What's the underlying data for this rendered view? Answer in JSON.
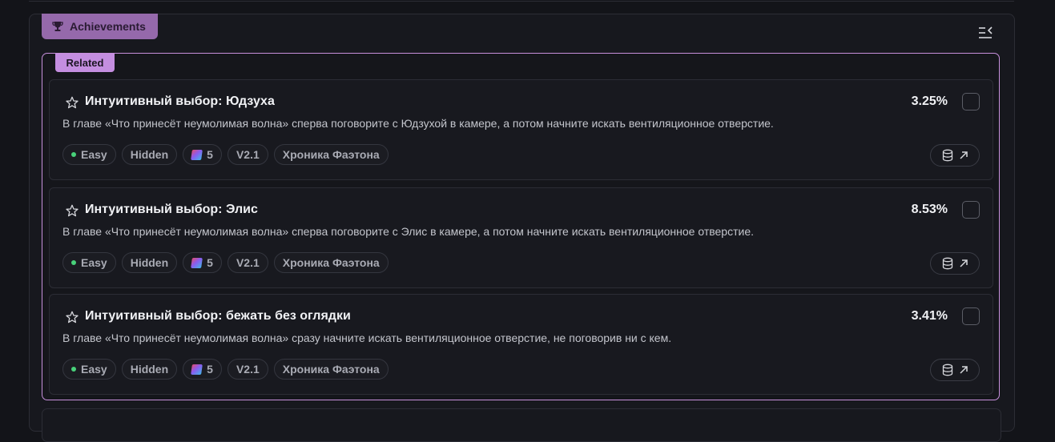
{
  "section": {
    "tab_label": "Achievements",
    "related_label": "Related",
    "collapse_icon": "collapse-list-icon"
  },
  "colors": {
    "accent": "#9569ab",
    "related_border": "#c790dc",
    "easy_dot": "#48d17a"
  },
  "achievements": [
    {
      "title": "Интуитивный выбор: Юдзуха",
      "percent": "3.25%",
      "description": "В главе «Что принесёт неумолимая волна» сперва поговорите с Юдзухой в камере, а потом начните искать вентиляционное отверстие.",
      "difficulty": "Easy",
      "visibility": "Hidden",
      "reward": "5",
      "version": "V2.1",
      "category": "Хроника Фаэтона"
    },
    {
      "title": "Интуитивный выбор: Элис",
      "percent": "8.53%",
      "description": "В главе «Что принесёт неумолимая волна» сперва поговорите с Элис в камере, а потом начните искать вентиляционное отверстие.",
      "difficulty": "Easy",
      "visibility": "Hidden",
      "reward": "5",
      "version": "V2.1",
      "category": "Хроника Фаэтона"
    },
    {
      "title": "Интуитивный выбор: бежать без оглядки",
      "percent": "3.41%",
      "description": "В главе «Что принесёт неумолимая волна» сразу начните искать вентиляционное отверстие, не поговорив ни с кем.",
      "difficulty": "Easy",
      "visibility": "Hidden",
      "reward": "5",
      "version": "V2.1",
      "category": "Хроника Фаэтона"
    }
  ]
}
